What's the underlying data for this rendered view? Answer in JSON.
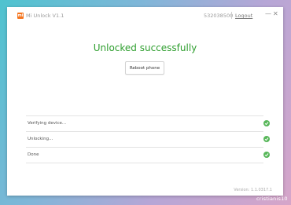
{
  "app": {
    "logo_text": "mi",
    "title": "Mi Unlock V1.1",
    "account_id": "532038500",
    "logout_label": "Logout",
    "minimize_glyph": "—",
    "close_glyph": "✕"
  },
  "main": {
    "heading": "Unlocked successfully",
    "reboot_label": "Reboot phone"
  },
  "steps": [
    {
      "label": "Verifying device...",
      "status": "done"
    },
    {
      "label": "Unlocking...",
      "status": "done"
    },
    {
      "label": "Done",
      "status": "done"
    }
  ],
  "footer": {
    "version": "Version: 1.1.0317.1"
  },
  "watermark": "cristianis10",
  "colors": {
    "accent_green": "#2e9e2e",
    "check_green": "#58b75a",
    "brand_orange": "#f5751e"
  }
}
